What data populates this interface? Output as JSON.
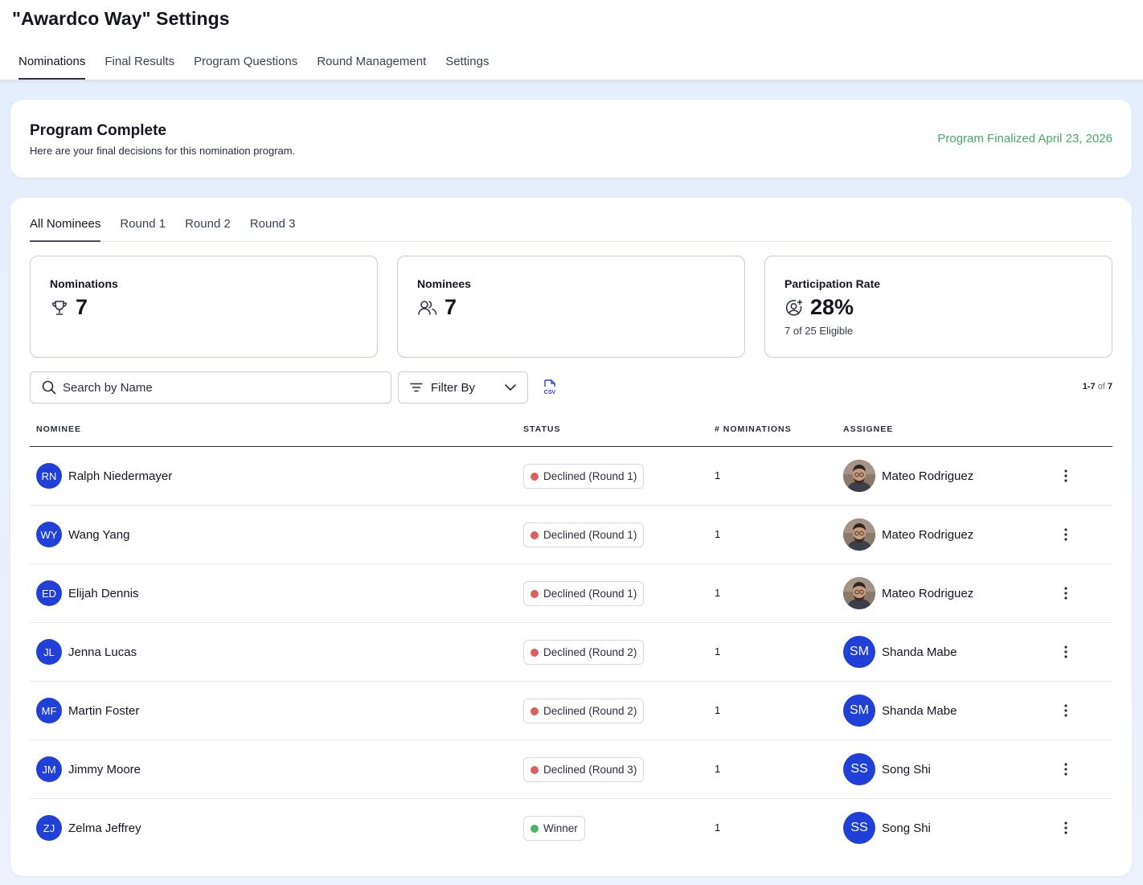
{
  "header": {
    "title": "\"Awardco Way\" Settings",
    "tabs": [
      {
        "label": "Nominations",
        "active": true
      },
      {
        "label": "Final Results",
        "active": false
      },
      {
        "label": "Program Questions",
        "active": false
      },
      {
        "label": "Round Management",
        "active": false
      },
      {
        "label": "Settings",
        "active": false
      }
    ]
  },
  "summary": {
    "title": "Program Complete",
    "subtitle": "Here are your final decisions for this nomination program.",
    "finalized": "Program Finalized April 23, 2026",
    "finalized_color": "#48a868"
  },
  "round_tabs": [
    {
      "label": "All Nominees",
      "active": true
    },
    {
      "label": "Round 1",
      "active": false
    },
    {
      "label": "Round 2",
      "active": false
    },
    {
      "label": "Round 3",
      "active": false
    }
  ],
  "stats": {
    "nominations": {
      "label": "Nominations",
      "value": "7",
      "icon": "trophy-icon"
    },
    "nominees": {
      "label": "Nominees",
      "value": "7",
      "icon": "users-icon"
    },
    "participation": {
      "label": "Participation Rate",
      "value": "28%",
      "note": "7 of 25 Eligible",
      "icon": "user-plus-icon"
    }
  },
  "toolbar": {
    "search_placeholder": "Search by Name",
    "filter_label": "Filter By",
    "csv_label": "CSV",
    "pager_range": "1-7",
    "pager_of": "of",
    "pager_total": "7"
  },
  "table": {
    "columns": [
      "NOMINEE",
      "STATUS",
      "# NOMINATIONS",
      "ASSIGNEE"
    ],
    "rows": [
      {
        "initials": "RN",
        "name": "Ralph Niedermayer",
        "status": "Declined (Round 1)",
        "status_type": "declined",
        "count": "1",
        "assignee": "Mateo Rodriguez",
        "assignee_initials": "",
        "assignee_photo": true
      },
      {
        "initials": "WY",
        "name": "Wang Yang",
        "status": "Declined (Round 1)",
        "status_type": "declined",
        "count": "1",
        "assignee": "Mateo Rodriguez",
        "assignee_initials": "",
        "assignee_photo": true
      },
      {
        "initials": "ED",
        "name": "Elijah Dennis",
        "status": "Declined (Round 1)",
        "status_type": "declined",
        "count": "1",
        "assignee": "Mateo Rodriguez",
        "assignee_initials": "",
        "assignee_photo": true
      },
      {
        "initials": "JL",
        "name": "Jenna Lucas",
        "status": "Declined (Round 2)",
        "status_type": "declined",
        "count": "1",
        "assignee": "Shanda Mabe",
        "assignee_initials": "SM",
        "assignee_photo": false
      },
      {
        "initials": "MF",
        "name": "Martin Foster",
        "status": "Declined (Round 2)",
        "status_type": "declined",
        "count": "1",
        "assignee": "Shanda Mabe",
        "assignee_initials": "SM",
        "assignee_photo": false
      },
      {
        "initials": "JM",
        "name": "Jimmy Moore",
        "status": "Declined (Round 3)",
        "status_type": "declined",
        "count": "1",
        "assignee": "Song Shi",
        "assignee_initials": "SS",
        "assignee_photo": false
      },
      {
        "initials": "ZJ",
        "name": "Zelma Jeffrey",
        "status": "Winner",
        "status_type": "winner",
        "count": "1",
        "assignee": "Song Shi",
        "assignee_initials": "SS",
        "assignee_photo": false
      }
    ]
  },
  "colors": {
    "declined": "#d9605c",
    "winner": "#4db36a",
    "avatar_blue": "#2140d8",
    "background": "#e5eefc"
  }
}
